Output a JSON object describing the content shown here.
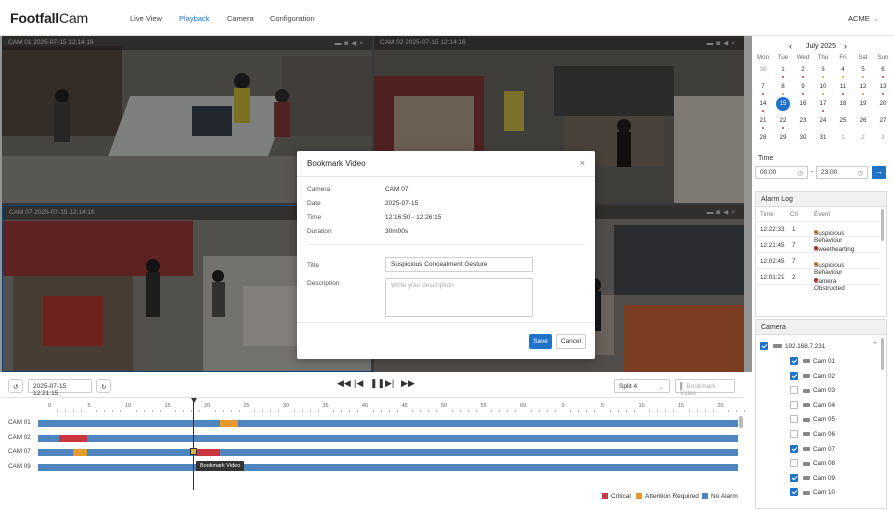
{
  "app": {
    "brand_bold": "Footfall",
    "brand_rest": "Cam",
    "user": "ACME"
  },
  "nav": {
    "live_view": "Live View",
    "playback": "Playback",
    "camera": "Camera",
    "configuration": "Configuration"
  },
  "videos": {
    "cells": [
      {
        "label": "CAM 01",
        "timestamp": "2025-07-15 12:14:16"
      },
      {
        "label": "CAM 02",
        "timestamp": "2025-07-15 12:14:16"
      },
      {
        "label": "CAM 07",
        "timestamp": "2025-07-15 12:14:16"
      },
      {
        "label": "",
        "timestamp": ""
      }
    ]
  },
  "modal": {
    "title": "Bookmark Video",
    "fields": [
      {
        "label": "Camera",
        "value": "CAM 07"
      },
      {
        "label": "Date",
        "value": "2025-07-15"
      },
      {
        "label": "Time",
        "value": "12:16:50 - 12:26:15"
      },
      {
        "label": "Duration",
        "value": "30m00s"
      }
    ],
    "title_label": "Title",
    "title_value": "Suspicious Concealment Gesture",
    "description_label": "Description",
    "description_placeholder": "Write your description",
    "save": "Save",
    "cancel": "Cancel"
  },
  "calendar": {
    "month": "July 2025",
    "weekdays": [
      "Mon",
      "Tue",
      "Wed",
      "Thu",
      "Fri",
      "Sat",
      "Sun"
    ],
    "weeks": [
      [
        "30",
        "1",
        "2",
        "3",
        "4",
        "5",
        "6"
      ],
      [
        "7",
        "8",
        "9",
        "10",
        "11",
        "12",
        "13"
      ],
      [
        "14",
        "15",
        "16",
        "17",
        "18",
        "19",
        "20"
      ],
      [
        "21",
        "22",
        "23",
        "24",
        "25",
        "26",
        "27"
      ],
      [
        "28",
        "29",
        "30",
        "31",
        "1",
        "2",
        "3"
      ]
    ],
    "selected": "15"
  },
  "time": {
    "label": "Time",
    "from": "00:00",
    "to": "23:00",
    "dash": "-"
  },
  "alarm_log": {
    "title": "Alarm Log",
    "headers": [
      "Time",
      "Ch",
      "Event"
    ],
    "rows": [
      {
        "time": "12:22:33",
        "ch": "1",
        "event": "Suspicious Behaviour",
        "color": "#e39b2e"
      },
      {
        "time": "12:21:45",
        "ch": "7",
        "event": "Sweethearting",
        "color": "#c9363e"
      },
      {
        "time": "12:02:45",
        "ch": "7",
        "event": "Suspicious Behaviour",
        "color": "#e39b2e"
      },
      {
        "time": "12:01:21",
        "ch": "2",
        "event": "Camera Obstructed",
        "color": "#c9363e"
      }
    ]
  },
  "camera_panel": {
    "title": "Camera",
    "nvr": "192.168.7.231",
    "cams": [
      {
        "name": "Cam 01",
        "checked": true
      },
      {
        "name": "Cam 02",
        "checked": true
      },
      {
        "name": "Cam 03",
        "checked": false
      },
      {
        "name": "Cam 04",
        "checked": false
      },
      {
        "name": "Cam 05",
        "checked": false
      },
      {
        "name": "Cam 06",
        "checked": false
      },
      {
        "name": "Cam 07",
        "checked": true
      },
      {
        "name": "Cam 08",
        "checked": false
      },
      {
        "name": "Cam 09",
        "checked": true
      },
      {
        "name": "Cam 10",
        "checked": true
      }
    ]
  },
  "controls": {
    "datetime": "2025-07-15 12:21:15",
    "split": "Split 4",
    "bookmark": "Bookmark Video"
  },
  "timeline": {
    "ticks": [
      "0",
      "5",
      "10",
      "15",
      "20",
      "25",
      "30",
      "35",
      "40",
      "45",
      "50",
      "55",
      "60",
      "0",
      "5",
      "10",
      "15",
      "20"
    ],
    "tracks": [
      {
        "label": "CAM 01",
        "segments": [
          {
            "start": 0.26,
            "end": 0.285,
            "color": "#e39b2e"
          }
        ]
      },
      {
        "label": "CAM 02",
        "segments": [
          {
            "start": 0.03,
            "end": 0.07,
            "color": "#c9363e"
          }
        ]
      },
      {
        "label": "CAM 07",
        "segments": [
          {
            "start": 0.05,
            "end": 0.07,
            "color": "#e39b2e"
          },
          {
            "start": 0.225,
            "end": 0.26,
            "color": "#c9363e"
          }
        ]
      },
      {
        "label": "CAM 09",
        "segments": []
      }
    ],
    "tooltip": "Bookmark Video",
    "legend": [
      {
        "label": "Critical",
        "color": "#c9363e"
      },
      {
        "label": "Attention Required",
        "color": "#e39b2e"
      },
      {
        "label": "No Alarm",
        "color": "#4f86c0"
      }
    ]
  }
}
